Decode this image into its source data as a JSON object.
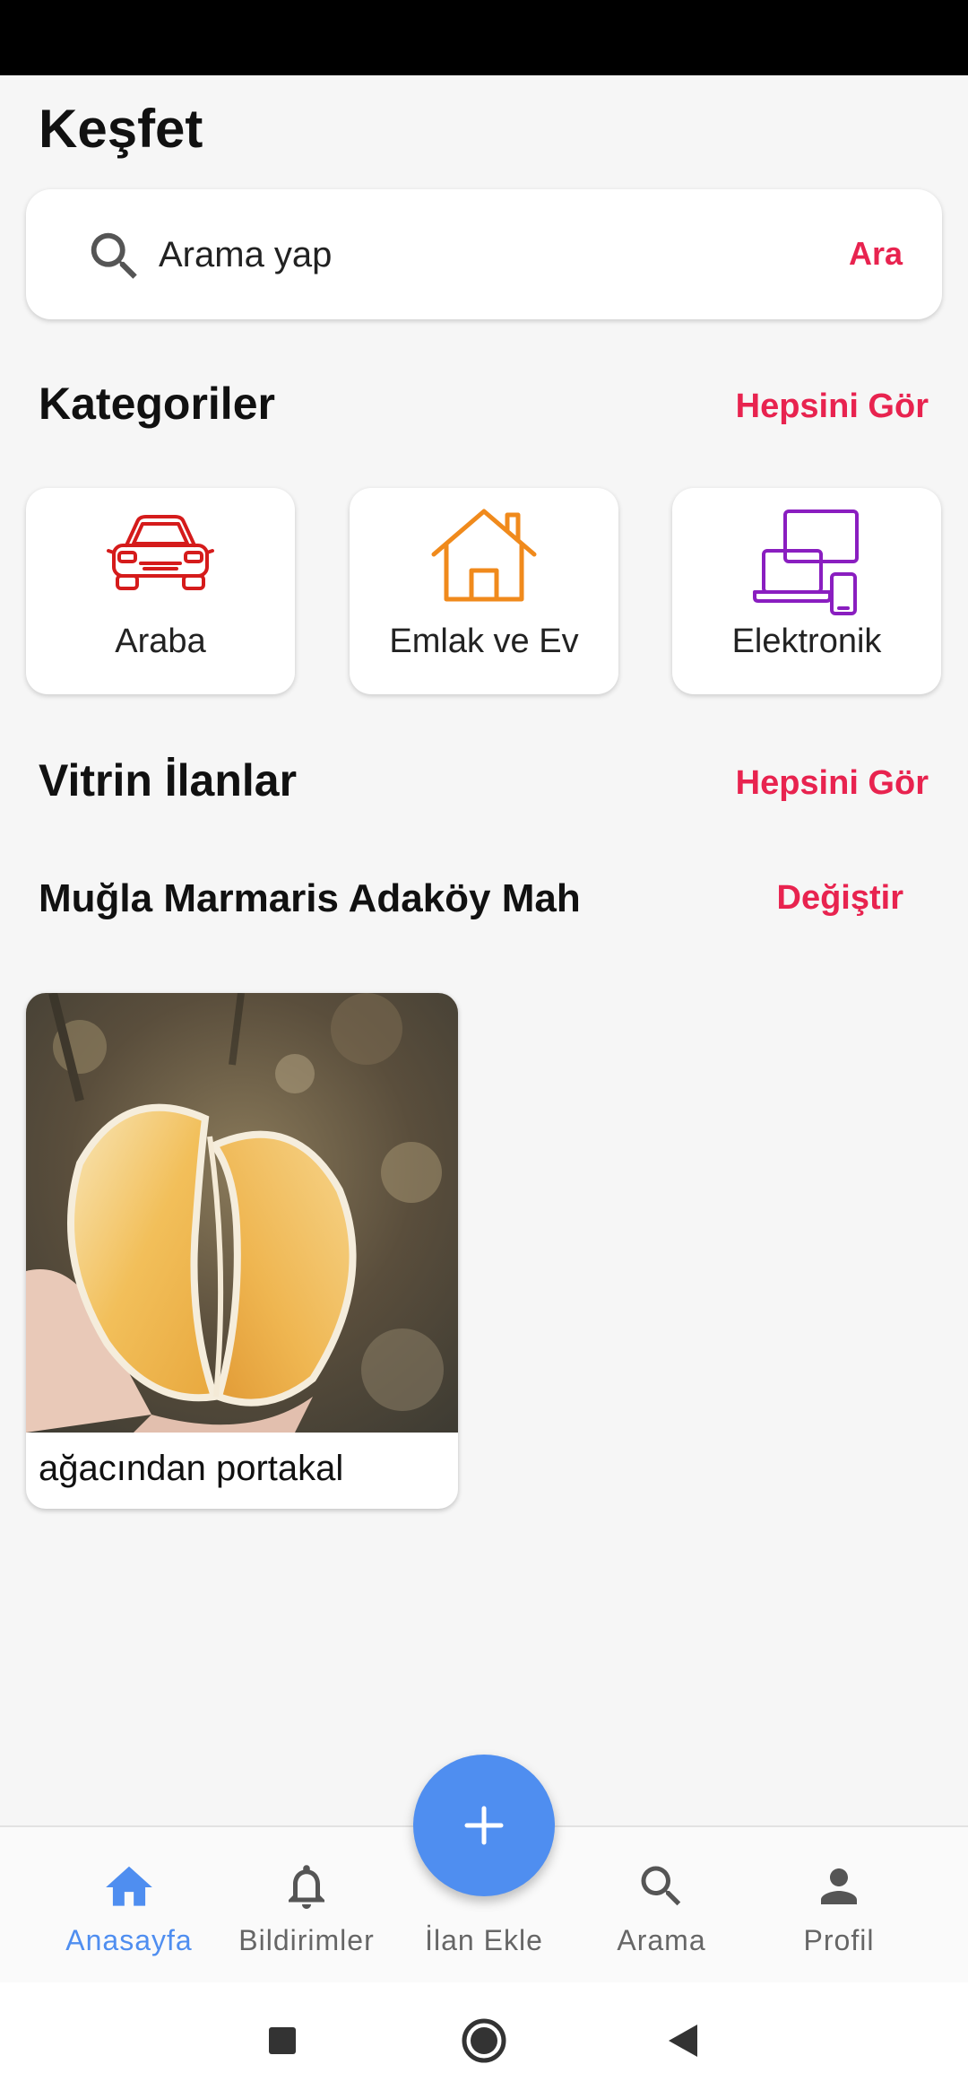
{
  "page": {
    "title": "Keşfet"
  },
  "search": {
    "placeholder": "Arama yap",
    "button_label": "Ara"
  },
  "categories": {
    "title": "Kategoriler",
    "see_all": "Hepsini Gör",
    "items": [
      {
        "label": "Araba",
        "icon": "car-icon",
        "color": "#d51b1b"
      },
      {
        "label": "Emlak ve Ev",
        "icon": "house-icon",
        "color": "#f08a1c"
      },
      {
        "label": "Elektronik",
        "icon": "devices-icon",
        "color": "#8a1ec0"
      }
    ]
  },
  "showcase": {
    "title": "Vitrin İlanlar",
    "see_all": "Hepsini Gör"
  },
  "location": {
    "name": "Muğla Marmaris Adaköy Mah",
    "change_label": "Değiştir"
  },
  "listings": [
    {
      "title": "ağacından portakal"
    }
  ],
  "bottom_nav": {
    "items": [
      {
        "label": "Anasayfa",
        "icon": "home-icon",
        "active": true
      },
      {
        "label": "Bildirimler",
        "icon": "bell-icon",
        "active": false
      },
      {
        "label": "İlan Ekle",
        "icon": "plus-icon",
        "active": false
      },
      {
        "label": "Arama",
        "icon": "search-icon",
        "active": false
      },
      {
        "label": "Profil",
        "icon": "person-icon",
        "active": false
      }
    ]
  },
  "colors": {
    "accent": "#e8234f",
    "primary": "#4f8ef0",
    "background": "#f6f6f6"
  }
}
